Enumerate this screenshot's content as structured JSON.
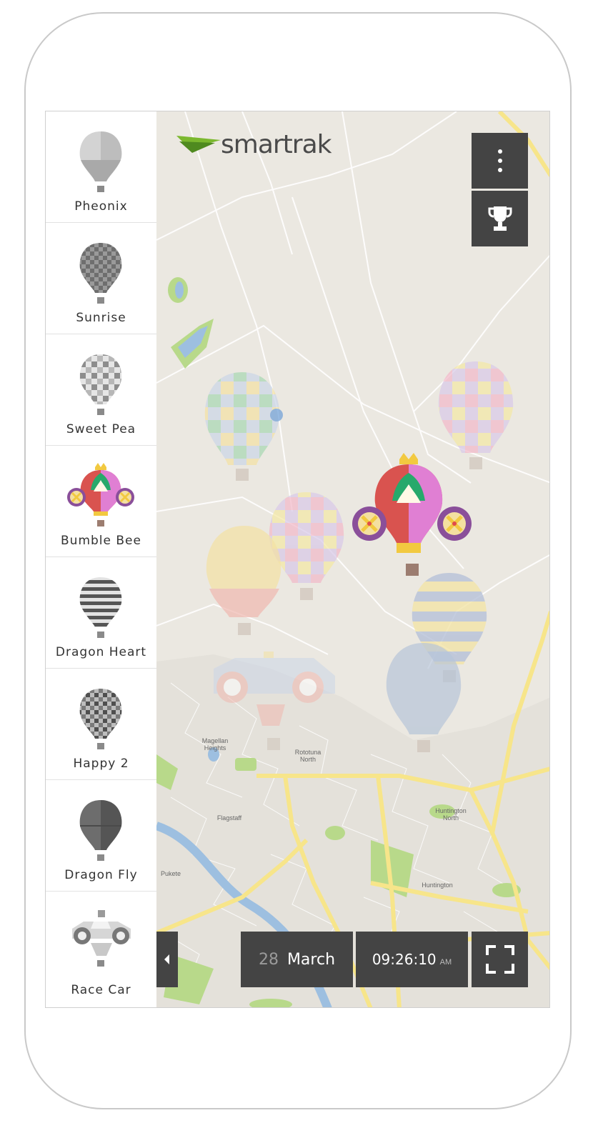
{
  "app": {
    "logo_text": "smartrak"
  },
  "balloons": [
    {
      "label": "Pheonix"
    },
    {
      "label": "Sunrise"
    },
    {
      "label": "Sweet Pea"
    },
    {
      "label": "Bumble Bee"
    },
    {
      "label": "Dragon Heart"
    },
    {
      "label": "Happy 2"
    },
    {
      "label": "Dragon Fly"
    },
    {
      "label": "Race Car"
    }
  ],
  "controls": {
    "date_day": "28",
    "date_month": "March",
    "time": "09:26:10",
    "time_period": "AM",
    "menu_icon": "vertical-dots-icon",
    "leaderboard_icon": "trophy-icon",
    "fullscreen_icon": "fullscreen-icon",
    "collapse_icon": "caret-left-icon"
  },
  "map_labels": {
    "magellan": "Magellan Heights",
    "rototuna": "Rototuna North",
    "flagstaff": "Flagstaff",
    "huntington_north": "Huntington North",
    "huntington": "Huntington",
    "pukete": "Pukete"
  },
  "colors": {
    "dark_button": "#444444",
    "map_background": "#ebe8e1",
    "road": "#f7e58a",
    "park": "#b8d98a",
    "water": "#9dbfe0"
  }
}
